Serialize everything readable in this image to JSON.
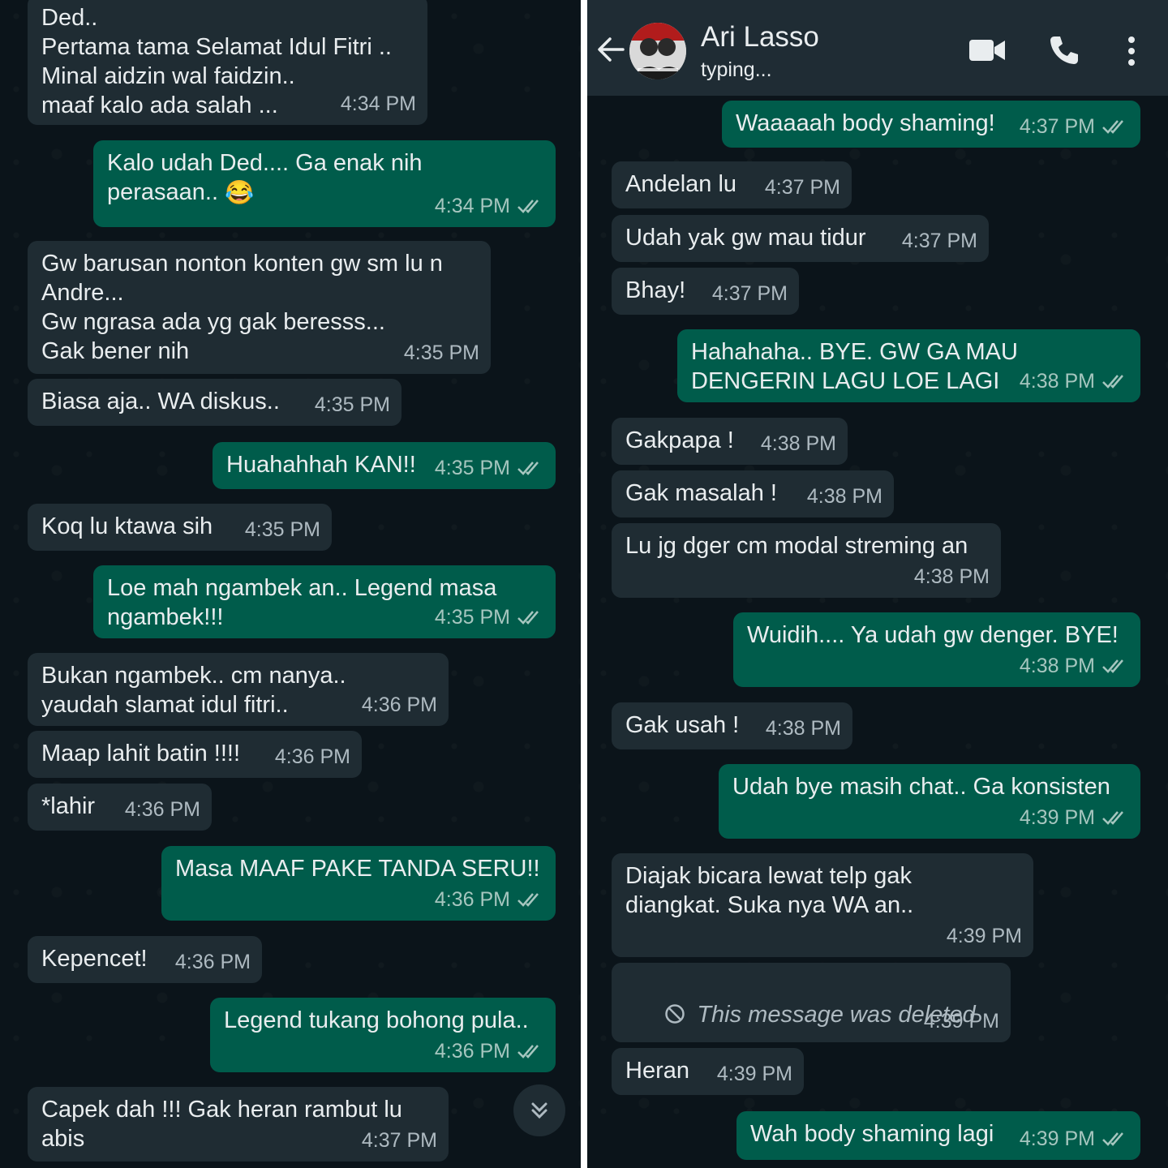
{
  "left_chat": {
    "messages": [
      {
        "dir": "in",
        "text": "Ded..\nPertama tama Selamat Idul Fitri ..\nMinal aidzin wal faidzin..\nmaaf kalo ada salah ...",
        "time": "4:34 PM"
      },
      {
        "dir": "out",
        "text": "Kalo udah Ded.... Ga enak nih\nperasaan.. ",
        "emoji": "😂",
        "time": "4:34 PM"
      },
      {
        "dir": "in",
        "text": "Gw barusan nonton konten gw sm lu n\nAndre...\nGw ngrasa ada yg gak beresss...\nGak bener nih",
        "time": "4:35 PM"
      },
      {
        "dir": "in",
        "text": "Biasa aja.. WA diskus..",
        "time": "4:35 PM"
      },
      {
        "dir": "out",
        "text": "Huahahhah KAN!!",
        "time": "4:35 PM"
      },
      {
        "dir": "in",
        "text": "Koq lu ktawa sih",
        "time": "4:35 PM"
      },
      {
        "dir": "out",
        "text": "Loe mah ngambek an.. Legend masa\nngambek!!!",
        "time": "4:35 PM"
      },
      {
        "dir": "in",
        "text": "Bukan ngambek.. cm nanya..\nyaudah slamat idul fitri..",
        "time": "4:36 PM"
      },
      {
        "dir": "in",
        "text": "Maap lahit batin !!!!",
        "time": "4:36 PM"
      },
      {
        "dir": "in",
        "text": "*lahir",
        "time": "4:36 PM"
      },
      {
        "dir": "out",
        "text": "Masa MAAF PAKE TANDA SERU!!",
        "time": "4:36 PM"
      },
      {
        "dir": "in",
        "text": "Kepencet!",
        "time": "4:36 PM"
      },
      {
        "dir": "out",
        "text": "Legend tukang bohong pula..",
        "time": "4:36 PM"
      },
      {
        "dir": "in",
        "text": "Capek dah !!! Gak heran rambut lu\nabis",
        "time": "4:37 PM"
      }
    ]
  },
  "right_chat": {
    "header": {
      "contact_name": "Ari Lasso",
      "status": "typing..."
    },
    "messages": [
      {
        "dir": "out",
        "text": "Waaaaah body shaming!",
        "time": "4:37 PM"
      },
      {
        "dir": "in",
        "text": "Andelan lu",
        "time": "4:37 PM"
      },
      {
        "dir": "in",
        "text": "Udah yak gw mau tidur",
        "time": "4:37 PM"
      },
      {
        "dir": "in",
        "text": "Bhay!",
        "time": "4:37 PM"
      },
      {
        "dir": "out",
        "text": "Hahahaha.. BYE. GW GA MAU\nDENGERIN LAGU LOE LAGI",
        "time": "4:38 PM"
      },
      {
        "dir": "in",
        "text": "Gakpapa !",
        "time": "4:38 PM"
      },
      {
        "dir": "in",
        "text": "Gak masalah !",
        "time": "4:38 PM"
      },
      {
        "dir": "in",
        "text": "Lu jg dger cm modal streming an",
        "time": "4:38 PM"
      },
      {
        "dir": "out",
        "text": "Wuidih.... Ya udah gw denger. BYE!",
        "time": "4:38 PM"
      },
      {
        "dir": "in",
        "text": "Gak usah !",
        "time": "4:38 PM"
      },
      {
        "dir": "out",
        "text": "Udah bye masih chat.. Ga konsisten",
        "time": "4:39 PM"
      },
      {
        "dir": "in",
        "text": "Diajak bicara lewat telp gak\ndiangkat. Suka nya WA an..",
        "time": "4:39 PM"
      },
      {
        "dir": "in",
        "deleted": true,
        "text": "This message was deleted",
        "time": "4:39 PM"
      },
      {
        "dir": "in",
        "text": "Heran",
        "time": "4:39 PM"
      },
      {
        "dir": "out",
        "text": "Wah body shaming lagi",
        "time": "4:39 PM"
      }
    ]
  },
  "icons": {
    "back": "back-arrow-icon",
    "video": "video-call-icon",
    "call": "phone-call-icon",
    "menu": "more-options-icon",
    "scroll": "scroll-down-icon",
    "deleted": "deleted-message-icon",
    "ticks": "double-check-icon"
  },
  "colors": {
    "background": "#0b141a",
    "incoming_bubble": "#1f2c33",
    "outgoing_bubble": "#005c4b",
    "header": "#1f2c34",
    "text": "#e9edef",
    "meta": "#aebac1",
    "read_ticks": "#a6c6bf"
  }
}
